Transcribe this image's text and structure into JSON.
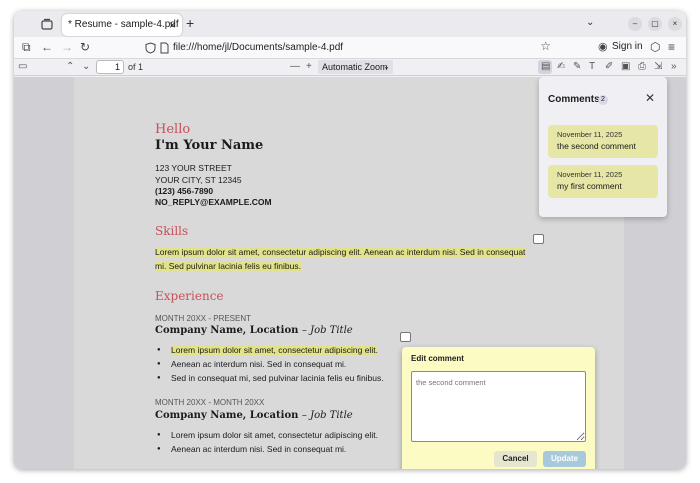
{
  "browser": {
    "tab_title": "* Resume - sample-4.pdf",
    "url": "file:///home/jl/Documents/sample-4.pdf",
    "signin_label": "Sign in"
  },
  "pdf_toolbar": {
    "page_number": "1",
    "page_of": "of 1",
    "zoom_label": "Automatic Zoom"
  },
  "document": {
    "hello": "Hello",
    "name": "I'm Your Name",
    "street": "123 YOUR STREET",
    "city": "YOUR CITY, ST 12345",
    "phone": "(123) 456-7890",
    "email": "NO_REPLY@EXAMPLE.COM",
    "skills_heading": "Skills",
    "skills_line1": "Lorem ipsum dolor sit amet, consectetur adipiscing elit. Aenean ac interdum nisi. Sed in consequat",
    "skills_line2": "mi. Sed pulvinar lacinia felis eu finibus.",
    "experience_heading": "Experience",
    "job1": {
      "month": "MONTH 20XX - PRESENT",
      "company": "Company Name, Location",
      "title": "– Job Title",
      "bullets": [
        "Lorem ipsum dolor sit amet, consectetur adipiscing elit.",
        "Aenean ac interdum nisi. Sed in consequat mi.",
        "Sed in consequat mi, sed pulvinar lacinia felis eu finibus."
      ]
    },
    "job2": {
      "month": "MONTH 20XX - MONTH 20XX",
      "company": "Company Name, Location",
      "title": "– Job Title",
      "bullets": [
        "Lorem ipsum dolor sit amet, consectetur adipiscing elit.",
        "Aenean ac interdum nisi. Sed in consequat mi."
      ]
    }
  },
  "comments_panel": {
    "title": "Comments",
    "count": "2",
    "items": [
      {
        "date": "November 11, 2025",
        "text": "the second comment"
      },
      {
        "date": "November 11, 2025",
        "text": "my first comment"
      }
    ]
  },
  "edit_comment": {
    "title": "Edit comment",
    "placeholder": "the second comment",
    "cancel_label": "Cancel",
    "update_label": "Update"
  },
  "colors": {
    "heading_accent": "#c8505a",
    "highlight": "#e2e28a",
    "comment_card": "#e6e6a6",
    "popup_bg": "#fdfbc4"
  }
}
